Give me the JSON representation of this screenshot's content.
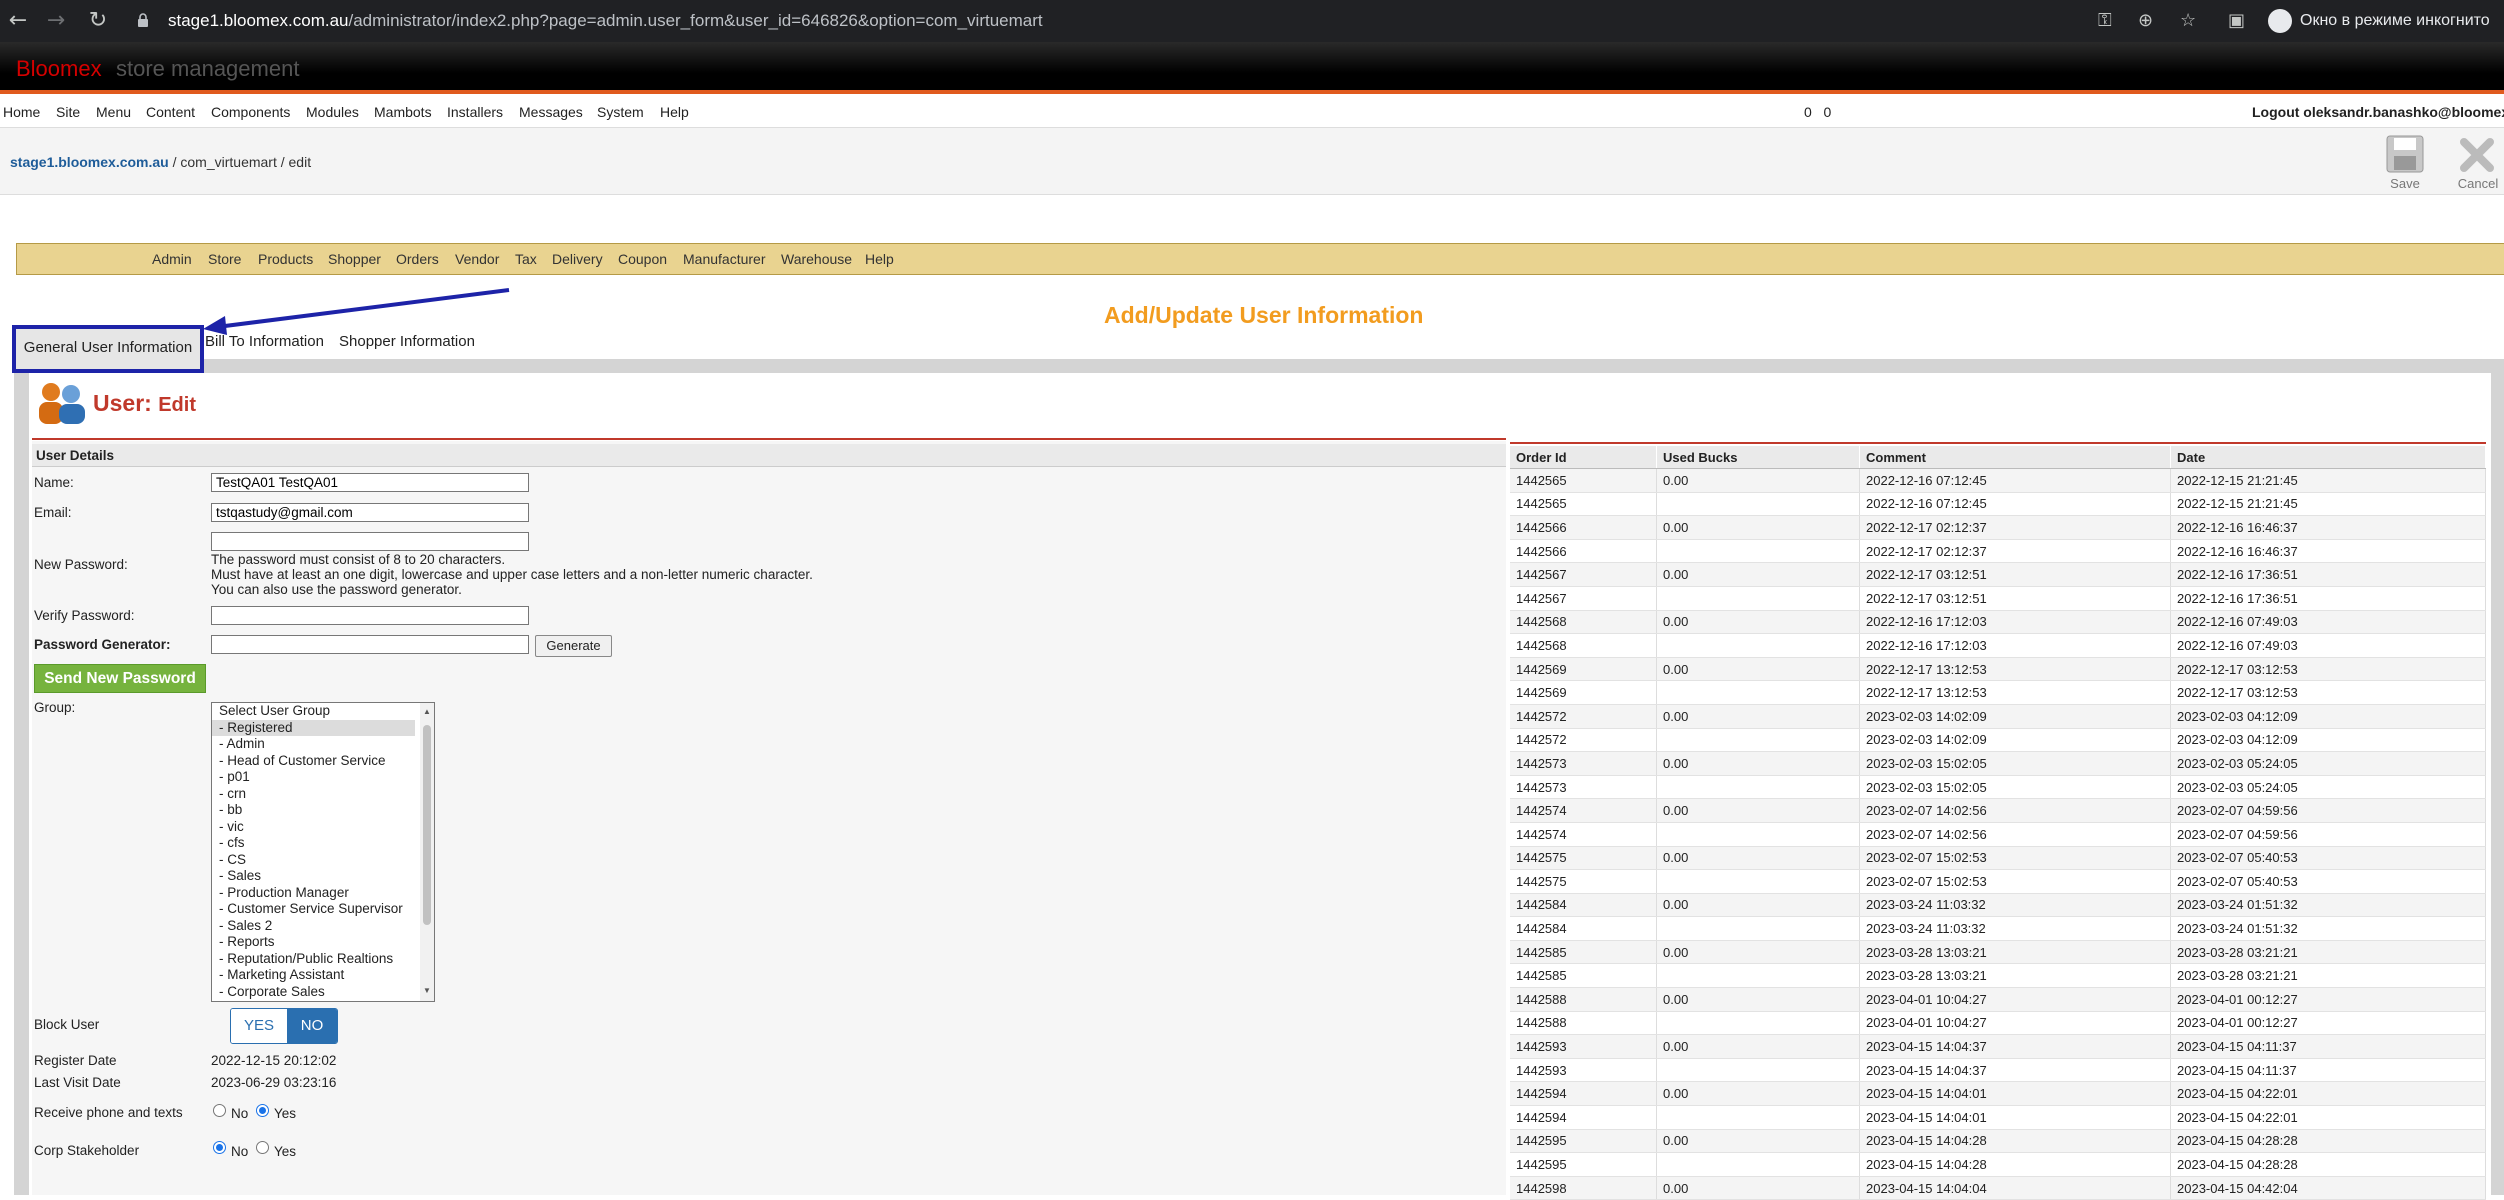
{
  "browser": {
    "url_host": "stage1.bloomex.com.au",
    "url_path": "/administrator/index2.php?page=admin.user_form&user_id=646826&option=com_virtuemart",
    "incognito_label": "Окно в режиме инкогнито"
  },
  "header": {
    "brand": "Bloomex",
    "subtitle": "store management"
  },
  "topmenu": {
    "items": [
      "Home",
      "Site",
      "Menu",
      "Content",
      "Components",
      "Modules",
      "Mambots",
      "Installers",
      "Messages",
      "System",
      "Help"
    ],
    "count1": "0",
    "count2": "0",
    "logout": "Logout oleksandr.banashko@bloomex"
  },
  "breadcrumb": {
    "site": "stage1.bloomex.com.au",
    "rest": " / com_virtuemart / edit"
  },
  "toolbar": {
    "save_label": "Save",
    "cancel_label": "Cancel"
  },
  "vmmenu": [
    "Admin",
    "Store",
    "Products",
    "Shopper",
    "Orders",
    "Vendor",
    "Tax",
    "Delivery",
    "Coupon",
    "Manufacturer",
    "Warehouse",
    "Help"
  ],
  "page_title": "Add/Update User Information",
  "tabs": [
    "General User Information",
    "Bill To Information",
    "Shopper Information"
  ],
  "user_edit": {
    "prefix": "User:",
    "mode": "Edit"
  },
  "form": {
    "section_title": "User Details",
    "name_label": "Name:",
    "name_value": "TestQA01 TestQA01",
    "email_label": "Email:",
    "email_value": "tstqastudy@gmail.com",
    "new_password_label": "New Password:",
    "password_note_1": "The password must consist of 8 to 20 characters.",
    "password_note_2": "Must have at least an one digit, lowercase and upper case letters and a non-letter numeric character.",
    "password_note_3": "You can also use the password generator.",
    "verify_password_label": "Verify Password:",
    "generator_label": "Password Generator:",
    "generate_button": "Generate",
    "send_password_button": "Send New Password",
    "group_label": "Group:",
    "groups": [
      "Select User Group",
      "- Registered",
      "- Admin",
      "- Head of Customer Service",
      "- p01",
      "- crn",
      "- bb",
      "- vic",
      "- cfs",
      "- CS",
      "- Sales",
      "- Production Manager",
      "- Customer Service Supervisor",
      "- Sales 2",
      "- Reports",
      "- Reputation/Public Realtions",
      "- Marketing Assistant",
      "- Corporate Sales"
    ],
    "selected_group": "- Registered",
    "block_user_label": "Block User",
    "yes": "YES",
    "no": "NO",
    "register_date_label": "Register Date",
    "register_date": "2022-12-15 20:12:02",
    "last_visit_label": "Last Visit Date",
    "last_visit": "2023-06-29 03:23:16",
    "receive_phone_label": "Receive phone and texts",
    "corp_stakeholder_label": "Corp Stakeholder",
    "radio_no": "No",
    "radio_yes": "Yes"
  },
  "orders": {
    "headers": [
      "Order Id",
      "Used Bucks",
      "Comment",
      "Date"
    ],
    "rows": [
      [
        "1442565",
        "0.00",
        "2022-12-16 07:12:45",
        "2022-12-15 21:21:45"
      ],
      [
        "1442565",
        "",
        "2022-12-16 07:12:45",
        "2022-12-15 21:21:45"
      ],
      [
        "1442566",
        "0.00",
        "2022-12-17 02:12:37",
        "2022-12-16 16:46:37"
      ],
      [
        "1442566",
        "",
        "2022-12-17 02:12:37",
        "2022-12-16 16:46:37"
      ],
      [
        "1442567",
        "0.00",
        "2022-12-17 03:12:51",
        "2022-12-16 17:36:51"
      ],
      [
        "1442567",
        "",
        "2022-12-17 03:12:51",
        "2022-12-16 17:36:51"
      ],
      [
        "1442568",
        "0.00",
        "2022-12-16 17:12:03",
        "2022-12-16 07:49:03"
      ],
      [
        "1442568",
        "",
        "2022-12-16 17:12:03",
        "2022-12-16 07:49:03"
      ],
      [
        "1442569",
        "0.00",
        "2022-12-17 13:12:53",
        "2022-12-17 03:12:53"
      ],
      [
        "1442569",
        "",
        "2022-12-17 13:12:53",
        "2022-12-17 03:12:53"
      ],
      [
        "1442572",
        "0.00",
        "2023-02-03 14:02:09",
        "2023-02-03 04:12:09"
      ],
      [
        "1442572",
        "",
        "2023-02-03 14:02:09",
        "2023-02-03 04:12:09"
      ],
      [
        "1442573",
        "0.00",
        "2023-02-03 15:02:05",
        "2023-02-03 05:24:05"
      ],
      [
        "1442573",
        "",
        "2023-02-03 15:02:05",
        "2023-02-03 05:24:05"
      ],
      [
        "1442574",
        "0.00",
        "2023-02-07 14:02:56",
        "2023-02-07 04:59:56"
      ],
      [
        "1442574",
        "",
        "2023-02-07 14:02:56",
        "2023-02-07 04:59:56"
      ],
      [
        "1442575",
        "0.00",
        "2023-02-07 15:02:53",
        "2023-02-07 05:40:53"
      ],
      [
        "1442575",
        "",
        "2023-02-07 15:02:53",
        "2023-02-07 05:40:53"
      ],
      [
        "1442584",
        "0.00",
        "2023-03-24 11:03:32",
        "2023-03-24 01:51:32"
      ],
      [
        "1442584",
        "",
        "2023-03-24 11:03:32",
        "2023-03-24 01:51:32"
      ],
      [
        "1442585",
        "0.00",
        "2023-03-28 13:03:21",
        "2023-03-28 03:21:21"
      ],
      [
        "1442585",
        "",
        "2023-03-28 13:03:21",
        "2023-03-28 03:21:21"
      ],
      [
        "1442588",
        "0.00",
        "2023-04-01 10:04:27",
        "2023-04-01 00:12:27"
      ],
      [
        "1442588",
        "",
        "2023-04-01 10:04:27",
        "2023-04-01 00:12:27"
      ],
      [
        "1442593",
        "0.00",
        "2023-04-15 14:04:37",
        "2023-04-15 04:11:37"
      ],
      [
        "1442593",
        "",
        "2023-04-15 14:04:37",
        "2023-04-15 04:11:37"
      ],
      [
        "1442594",
        "0.00",
        "2023-04-15 14:04:01",
        "2023-04-15 04:22:01"
      ],
      [
        "1442594",
        "",
        "2023-04-15 14:04:01",
        "2023-04-15 04:22:01"
      ],
      [
        "1442595",
        "0.00",
        "2023-04-15 14:04:28",
        "2023-04-15 04:28:28"
      ],
      [
        "1442595",
        "",
        "2023-04-15 14:04:28",
        "2023-04-15 04:28:28"
      ],
      [
        "1442598",
        "0.00",
        "2023-04-15 14:04:04",
        "2023-04-15 04:42:04"
      ]
    ]
  }
}
